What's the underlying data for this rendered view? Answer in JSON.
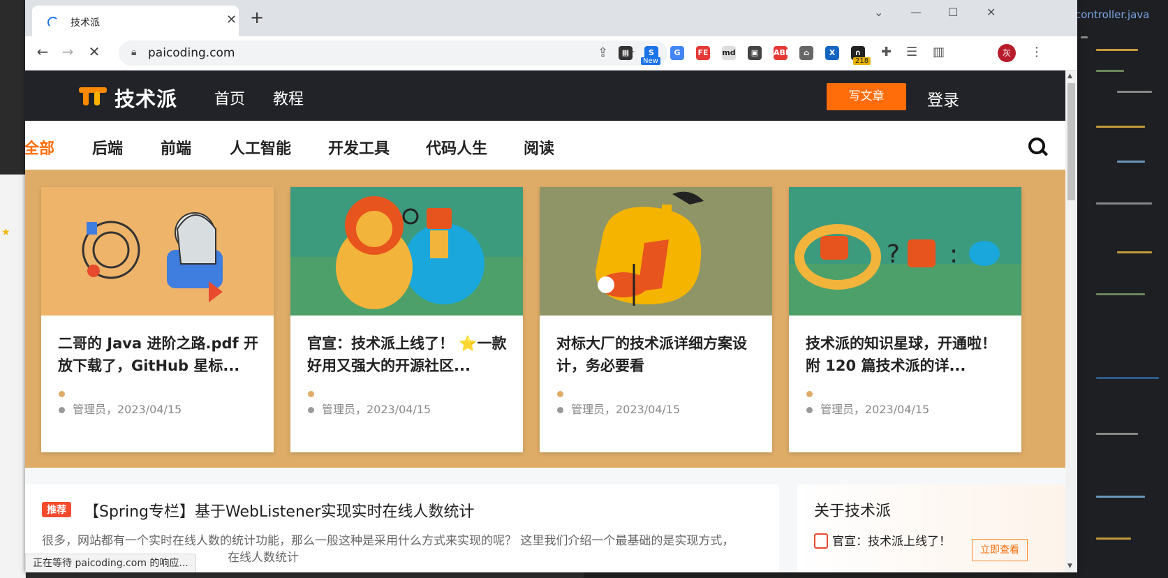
{
  "ide": {
    "tab_label": "controller.java"
  },
  "browser": {
    "tab_title": "技术派",
    "new_tab": "+",
    "url": "paicoding.com",
    "extensions": [
      {
        "name": "qr-code-icon",
        "label": "▦",
        "bg": "#333"
      },
      {
        "name": "new-extension-icon",
        "label": "S",
        "bg": "#1a73e8"
      },
      {
        "name": "translate-icon",
        "label": "G",
        "bg": "#4285f4"
      },
      {
        "name": "fe-helper-icon",
        "label": "FE",
        "bg": "#e53935"
      },
      {
        "name": "markdown-icon",
        "label": "md",
        "bg": "#ddd"
      },
      {
        "name": "qr-scan-icon",
        "label": "▣",
        "bg": "#444"
      },
      {
        "name": "adblock-icon",
        "label": "ABP",
        "bg": "#e53935"
      },
      {
        "name": "extension-house-icon",
        "label": "⌂",
        "bg": "#666"
      },
      {
        "name": "x-extension-icon",
        "label": "X",
        "bg": "#1565c0"
      },
      {
        "name": "counter-extension-icon",
        "label": "∩",
        "bg": "#222"
      }
    ],
    "badge_new": "New",
    "badge_count": "218",
    "avatar_label": "灰",
    "status_text": "正在等待 paicoding.com 的响应..."
  },
  "site": {
    "logo_text": "技术派",
    "nav": [
      "首页",
      "教程"
    ],
    "write_button": "写文章",
    "login": "登录",
    "categories": [
      "全部",
      "后端",
      "前端",
      "人工智能",
      "开发工具",
      "代码人生",
      "阅读"
    ],
    "active_category": "全部"
  },
  "cards": [
    {
      "title": "二哥的 Java 进阶之路.pdf 开放下载了，GitHub 星标...",
      "meta": "管理员，2023/04/15"
    },
    {
      "title": "官宣：技术派上线了！ ⭐一款好用又强大的开源社区...",
      "meta": "管理员，2023/04/15"
    },
    {
      "title": "对标大厂的技术派详细方案设计，务必要看",
      "meta": "管理员，2023/04/15"
    },
    {
      "title": "技术派的知识星球，开通啦！附 120 篇技术派的详...",
      "meta": "管理员，2023/04/15"
    }
  ],
  "article": {
    "tag": "推荐",
    "title": "【Spring专栏】基于WebListener实现实时在线人数统计",
    "desc": "很多，网站都有一个实时在线人数的统计功能，那么一般这种是采用什么方式来实现的呢？ 这里我们介绍一个最基础的是实现方式，",
    "desc2": "在线人数统计"
  },
  "sidebar": {
    "title": "关于技术派",
    "item": "官宣：技术派上线了！",
    "button": "立即查看"
  },
  "colors": {
    "accent": "#ff6d0a",
    "header_bg": "#212328",
    "banner_bg": "#deac67"
  }
}
